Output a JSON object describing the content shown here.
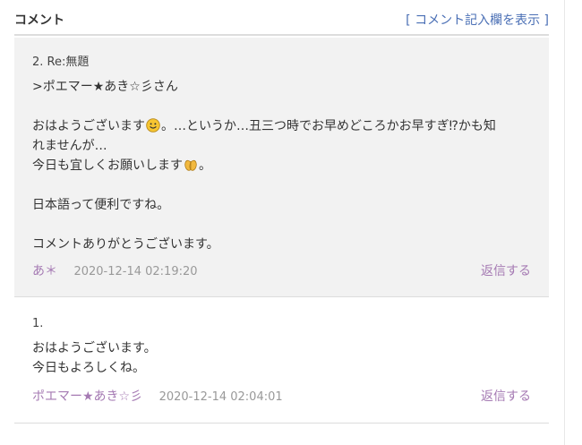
{
  "header": {
    "title": "コメント",
    "bracket_open": "[",
    "link_label": "コメント記入欄を表示",
    "bracket_close": "]"
  },
  "comments": [
    {
      "title": "2. Re:無題",
      "lines": {
        "l1": ">ポエマー★あき☆彡さん",
        "l2a": "おはようございます",
        "l2b": "。…というか…丑三つ時でお早めどころかお早すぎ⁉かも知",
        "l3": "れませんが…",
        "l4a": "今日も宜しくお願いします",
        "l4b": "。",
        "l5": "日本語って便利ですね。",
        "l6": "コメントありがとうございます。"
      },
      "emoji": [
        "smiley-face",
        "praying-hands"
      ],
      "author": "あ＊",
      "date": "2020-12-14 02:19:20",
      "reply_label": "返信する"
    },
    {
      "title": "1.",
      "lines": {
        "l1": "おはようございます。",
        "l2": "今日もよろしくね。"
      },
      "author": "ポエマー★あき☆彡",
      "date": "2020-12-14 02:04:01",
      "reply_label": "返信する"
    }
  ],
  "colors": {
    "link_blue": "#4a6fb5",
    "author_purple": "#a57ab3",
    "date_gray": "#999999",
    "comment_bg": "#f2f2f2"
  }
}
